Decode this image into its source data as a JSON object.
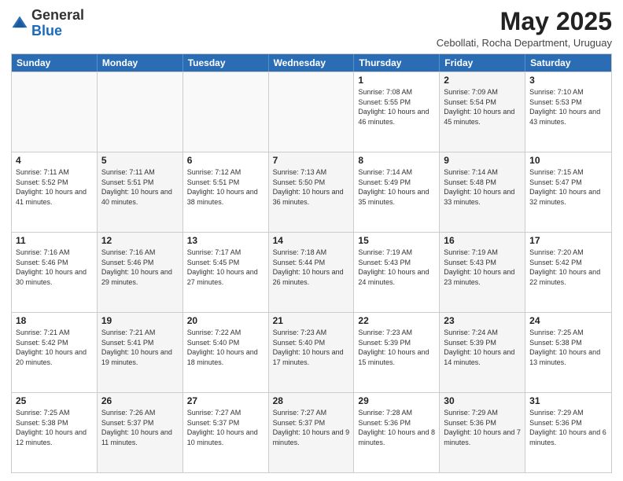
{
  "logo": {
    "general": "General",
    "blue": "Blue"
  },
  "title": "May 2025",
  "subtitle": "Cebollati, Rocha Department, Uruguay",
  "headers": [
    "Sunday",
    "Monday",
    "Tuesday",
    "Wednesday",
    "Thursday",
    "Friday",
    "Saturday"
  ],
  "rows": [
    [
      {
        "day": "",
        "info": "",
        "empty": true
      },
      {
        "day": "",
        "info": "",
        "empty": true
      },
      {
        "day": "",
        "info": "",
        "empty": true
      },
      {
        "day": "",
        "info": "",
        "empty": true
      },
      {
        "day": "1",
        "info": "Sunrise: 7:08 AM\nSunset: 5:55 PM\nDaylight: 10 hours and 46 minutes."
      },
      {
        "day": "2",
        "info": "Sunrise: 7:09 AM\nSunset: 5:54 PM\nDaylight: 10 hours and 45 minutes."
      },
      {
        "day": "3",
        "info": "Sunrise: 7:10 AM\nSunset: 5:53 PM\nDaylight: 10 hours and 43 minutes."
      }
    ],
    [
      {
        "day": "4",
        "info": "Sunrise: 7:11 AM\nSunset: 5:52 PM\nDaylight: 10 hours and 41 minutes."
      },
      {
        "day": "5",
        "info": "Sunrise: 7:11 AM\nSunset: 5:51 PM\nDaylight: 10 hours and 40 minutes."
      },
      {
        "day": "6",
        "info": "Sunrise: 7:12 AM\nSunset: 5:51 PM\nDaylight: 10 hours and 38 minutes."
      },
      {
        "day": "7",
        "info": "Sunrise: 7:13 AM\nSunset: 5:50 PM\nDaylight: 10 hours and 36 minutes."
      },
      {
        "day": "8",
        "info": "Sunrise: 7:14 AM\nSunset: 5:49 PM\nDaylight: 10 hours and 35 minutes."
      },
      {
        "day": "9",
        "info": "Sunrise: 7:14 AM\nSunset: 5:48 PM\nDaylight: 10 hours and 33 minutes."
      },
      {
        "day": "10",
        "info": "Sunrise: 7:15 AM\nSunset: 5:47 PM\nDaylight: 10 hours and 32 minutes."
      }
    ],
    [
      {
        "day": "11",
        "info": "Sunrise: 7:16 AM\nSunset: 5:46 PM\nDaylight: 10 hours and 30 minutes."
      },
      {
        "day": "12",
        "info": "Sunrise: 7:16 AM\nSunset: 5:46 PM\nDaylight: 10 hours and 29 minutes."
      },
      {
        "day": "13",
        "info": "Sunrise: 7:17 AM\nSunset: 5:45 PM\nDaylight: 10 hours and 27 minutes."
      },
      {
        "day": "14",
        "info": "Sunrise: 7:18 AM\nSunset: 5:44 PM\nDaylight: 10 hours and 26 minutes."
      },
      {
        "day": "15",
        "info": "Sunrise: 7:19 AM\nSunset: 5:43 PM\nDaylight: 10 hours and 24 minutes."
      },
      {
        "day": "16",
        "info": "Sunrise: 7:19 AM\nSunset: 5:43 PM\nDaylight: 10 hours and 23 minutes."
      },
      {
        "day": "17",
        "info": "Sunrise: 7:20 AM\nSunset: 5:42 PM\nDaylight: 10 hours and 22 minutes."
      }
    ],
    [
      {
        "day": "18",
        "info": "Sunrise: 7:21 AM\nSunset: 5:42 PM\nDaylight: 10 hours and 20 minutes."
      },
      {
        "day": "19",
        "info": "Sunrise: 7:21 AM\nSunset: 5:41 PM\nDaylight: 10 hours and 19 minutes."
      },
      {
        "day": "20",
        "info": "Sunrise: 7:22 AM\nSunset: 5:40 PM\nDaylight: 10 hours and 18 minutes."
      },
      {
        "day": "21",
        "info": "Sunrise: 7:23 AM\nSunset: 5:40 PM\nDaylight: 10 hours and 17 minutes."
      },
      {
        "day": "22",
        "info": "Sunrise: 7:23 AM\nSunset: 5:39 PM\nDaylight: 10 hours and 15 minutes."
      },
      {
        "day": "23",
        "info": "Sunrise: 7:24 AM\nSunset: 5:39 PM\nDaylight: 10 hours and 14 minutes."
      },
      {
        "day": "24",
        "info": "Sunrise: 7:25 AM\nSunset: 5:38 PM\nDaylight: 10 hours and 13 minutes."
      }
    ],
    [
      {
        "day": "25",
        "info": "Sunrise: 7:25 AM\nSunset: 5:38 PM\nDaylight: 10 hours and 12 minutes."
      },
      {
        "day": "26",
        "info": "Sunrise: 7:26 AM\nSunset: 5:37 PM\nDaylight: 10 hours and 11 minutes."
      },
      {
        "day": "27",
        "info": "Sunrise: 7:27 AM\nSunset: 5:37 PM\nDaylight: 10 hours and 10 minutes."
      },
      {
        "day": "28",
        "info": "Sunrise: 7:27 AM\nSunset: 5:37 PM\nDaylight: 10 hours and 9 minutes."
      },
      {
        "day": "29",
        "info": "Sunrise: 7:28 AM\nSunset: 5:36 PM\nDaylight: 10 hours and 8 minutes."
      },
      {
        "day": "30",
        "info": "Sunrise: 7:29 AM\nSunset: 5:36 PM\nDaylight: 10 hours and 7 minutes."
      },
      {
        "day": "31",
        "info": "Sunrise: 7:29 AM\nSunset: 5:36 PM\nDaylight: 10 hours and 6 minutes."
      }
    ]
  ]
}
